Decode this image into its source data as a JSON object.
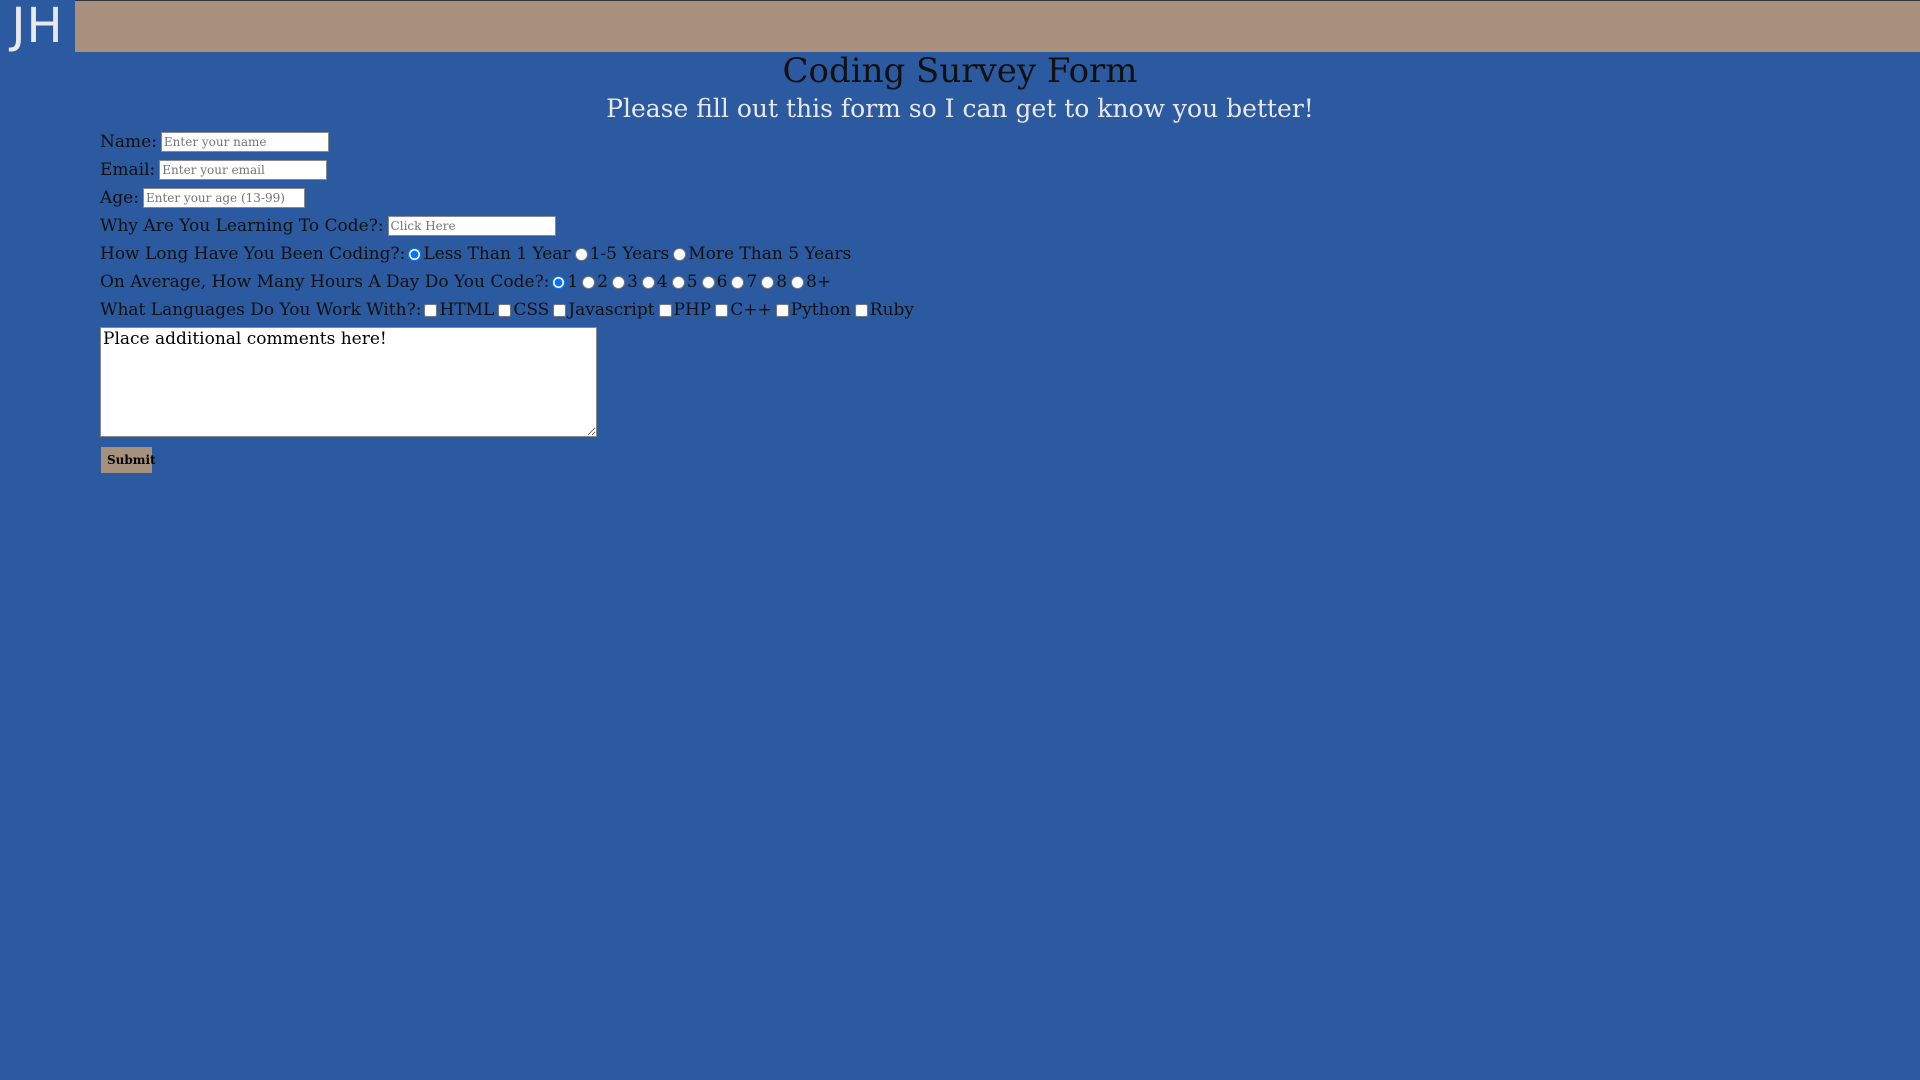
{
  "header": {
    "logo": "JH"
  },
  "page": {
    "title": "Coding Survey Form",
    "subtitle": "Please fill out this form so I can get to know you better!"
  },
  "form": {
    "name": {
      "label": "Name:",
      "placeholder": "Enter your name",
      "value": ""
    },
    "email": {
      "label": "Email:",
      "placeholder": "Enter your email",
      "value": ""
    },
    "age": {
      "label": "Age:",
      "placeholder": "Enter your age (13-99)",
      "value": ""
    },
    "why": {
      "label": "Why Are You Learning To Code?:",
      "placeholder": "Click Here",
      "value": ""
    },
    "duration": {
      "label": "How Long Have You Been Coding?:",
      "options": [
        "Less Than 1 Year",
        "1-5 Years",
        "More Than 5 Years"
      ],
      "selected": "Less Than 1 Year"
    },
    "hours": {
      "label": "On Average, How Many Hours A Day Do You Code?:",
      "options": [
        "1",
        "2",
        "3",
        "4",
        "5",
        "6",
        "7",
        "8",
        "8+"
      ],
      "selected": "1"
    },
    "languages": {
      "label": "What Languages Do You Work With?:",
      "options": [
        "HTML",
        "CSS",
        "Javascript",
        "PHP",
        "C++",
        "Python",
        "Ruby"
      ],
      "checked": []
    },
    "comments": {
      "value": "Place additional comments here!"
    },
    "submit_label": "Submit"
  },
  "colors": {
    "background": "#2b5aa0",
    "topbar": "#a8917c",
    "button": "#a8917c",
    "subtitle": "#e8e8e8"
  }
}
